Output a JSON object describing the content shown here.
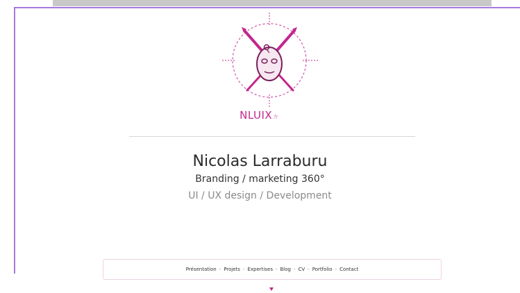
{
  "brand": {
    "name": "NLUIX",
    "tld": ".fr",
    "accent_color": "#c2278f"
  },
  "hero": {
    "name": "Nicolas Larraburu",
    "tagline": "Branding / marketing 360°",
    "subtagline": "UI / UX design / Development"
  },
  "nav": {
    "items": [
      {
        "label": "Présentation"
      },
      {
        "label": "Projets"
      },
      {
        "label": "Expertises"
      },
      {
        "label": "Blog"
      },
      {
        "label": "CV"
      },
      {
        "label": "Portfolio"
      },
      {
        "label": "Contact"
      }
    ],
    "separators": [
      "-",
      "-",
      "-",
      "-",
      "-",
      "-"
    ]
  },
  "icons": {
    "logo": "artist-mask-logo-icon",
    "scroll": "caret-down-icon"
  }
}
